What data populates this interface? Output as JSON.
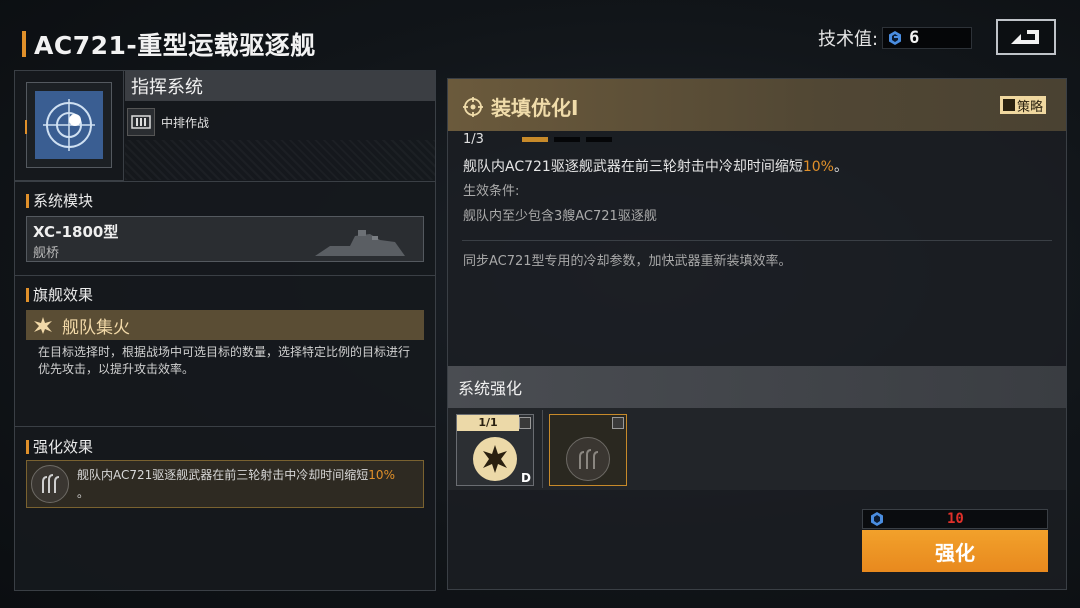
{
  "header": {
    "title": "AC721-重型运载驱逐舰",
    "tech_label": "技术值:",
    "tech_value": "6",
    "back_icon": "back-arrow-icon"
  },
  "left": {
    "system_name": "指挥系统",
    "tag": "中排作战",
    "module_section": "系统模块",
    "module_name": "XC-1800型",
    "module_type": "舰桥",
    "flagship_section": "旗舰效果",
    "flagship_effect": "舰队集火",
    "flagship_desc": "在目标选择时，根据战场中可选目标的数量，选择特定比例的目标进行优先攻击，以提升攻击效率。",
    "enhance_section": "强化效果",
    "enhance_desc_main": "舰队内AC721驱逐舰武器在前三轮射击中冷却时间缩短",
    "enhance_desc_pct": "10%",
    "enhance_desc_tail": "。"
  },
  "right": {
    "title": "装填优化I",
    "strategy_label": "策略",
    "progress": "1/3",
    "progress_value": 1,
    "progress_max": 3,
    "desc_main": "舰队内AC721驱逐舰武器在前三轮射击中冷却时间缩短",
    "desc_pct": "10%",
    "desc_end": "。",
    "cond_label": "生效条件:",
    "cond_text": "舰队内至少包含3艘AC721驱逐舰",
    "flavor": "同步AC721型专用的冷却参数，加快武器重新装填效率。",
    "enhance_head": "系统强化",
    "slot1_count": "1/1",
    "slot1_grade": "D",
    "cost": "10",
    "upgrade_label": "强化"
  },
  "colors": {
    "accent": "#e0902a",
    "upgrade_button": "#ee9624",
    "cost_red": "#e0302a",
    "tech_gem": "#4a8de0"
  }
}
